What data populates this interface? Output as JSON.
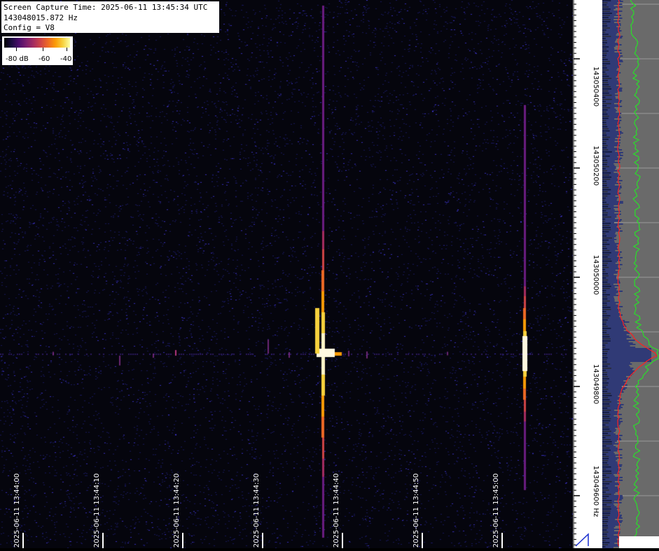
{
  "info": {
    "capture_time": "Screen Capture Time: 2025-06-11 13:45:34 UTC",
    "frequency": "143048015.872 Hz",
    "config": "Config = V8"
  },
  "colorbar": {
    "labels": [
      "-80 dB",
      "-60",
      "-40"
    ]
  },
  "time_axis": {
    "labels": [
      "2025-06-11 13:44:00",
      "2025-06-11 13:44:10",
      "2025-06-11 13:44:20",
      "2025-06-11 13:44:30",
      "2025-06-11 13:44:40",
      "2025-06-11 13:44:50",
      "2025-06-11 13:45:00"
    ]
  },
  "freq_axis": {
    "labels": [
      "143050400",
      "143050200",
      "143050000",
      "143049800",
      "143049600 Hz"
    ]
  },
  "colors": {
    "background": "#05050d",
    "spectrum_bg": "#6a6a6a",
    "spectrum_blue": "#1c2a7a",
    "avg_line": "#ff2020",
    "peak_line": "#28e028"
  }
}
